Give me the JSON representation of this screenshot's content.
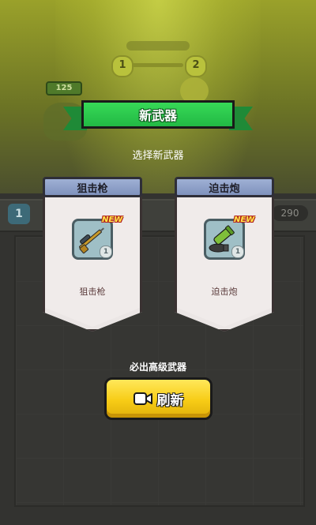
{
  "background": {
    "stage_left": "1",
    "stage_right": "2",
    "hero_hp": "125",
    "player_level": "1",
    "coins": "290"
  },
  "modal": {
    "title": "新武器",
    "subtitle": "选择新武器",
    "cards": [
      {
        "title": "狙击枪",
        "name": "狙击枪",
        "new_tag": "NEW",
        "level": "1",
        "icon": "sniper-rifle-icon"
      },
      {
        "title": "迫击炮",
        "name": "迫击炮",
        "new_tag": "NEW",
        "level": "1",
        "icon": "mortar-icon"
      }
    ],
    "hint": "必出高级武器",
    "refresh_button": {
      "label": "刷新",
      "icon": "video-icon"
    }
  },
  "colors": {
    "ribbon_green": "#22b944",
    "button_yellow": "#f7cc16",
    "card_header_blue": "#8fa0c8",
    "new_tag": "#ffe84a"
  }
}
